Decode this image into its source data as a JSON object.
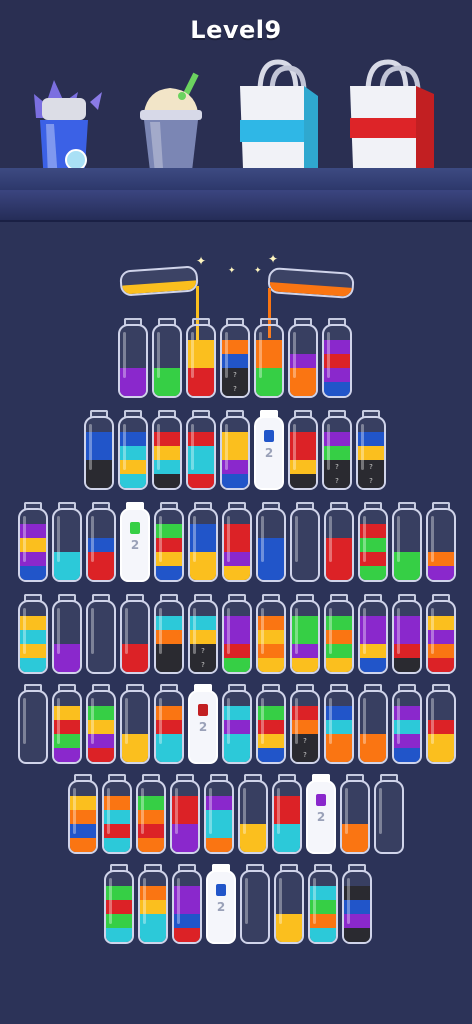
{
  "header": {
    "title": "Level9"
  },
  "colors": {
    "P": "#8a28cc",
    "G": "#36cf45",
    "R": "#dc2226",
    "Y": "#fbbf1e",
    "B": "#2155c9",
    "O": "#fa7512",
    "C": "#2cc9d9",
    "K": "#2a2a30",
    "W": "#f4f5fa"
  },
  "rewards": [
    {
      "name": "blue-cup-with-plant",
      "icon": "blue-drink-icon"
    },
    {
      "name": "milkshake",
      "icon": "milkshake-icon"
    },
    {
      "name": "shopping-bag-blue",
      "icon": "blue-shopping-bag-icon"
    },
    {
      "name": "shopping-bag-red",
      "icon": "red-shopping-bag-icon"
    }
  ],
  "pour_left": {
    "color": "Y"
  },
  "pour_right": {
    "color": "O"
  },
  "rows": [
    [
      [
        "P",
        "P"
      ],
      [
        "G",
        "G"
      ],
      [
        "R",
        "R",
        "Y",
        "Y"
      ],
      [
        "?",
        "?",
        "B",
        "O"
      ],
      [
        "G",
        "G",
        "O",
        "O"
      ],
      [
        "O",
        "O",
        "P"
      ],
      [
        "B",
        "P",
        "R",
        "P"
      ]
    ],
    [
      [
        "K",
        "K",
        "B",
        "B"
      ],
      [
        "C",
        "Y",
        "C",
        "B"
      ],
      [
        "K",
        "C",
        "Y",
        "R"
      ],
      [
        "R",
        "C",
        "C",
        "R"
      ],
      [
        "B",
        "P",
        "Y",
        "Y"
      ],
      [
        "W2"
      ],
      [
        "K",
        "Y",
        "R",
        "R"
      ],
      [
        "?",
        "?",
        "G",
        "P"
      ],
      [
        "?",
        "?",
        "Y",
        "B"
      ]
    ],
    [
      [
        "B",
        "P",
        "Y",
        "P"
      ],
      [
        "C",
        "C"
      ],
      [
        "R",
        "R",
        "B"
      ],
      [
        "W2"
      ],
      [
        "B",
        "Y",
        "R",
        "G"
      ],
      [
        "Y",
        "Y",
        "B",
        "B"
      ],
      [
        "Y",
        "P",
        "R",
        "R"
      ],
      [
        "B",
        "B",
        "B"
      ],
      [],
      [
        "R",
        "R",
        "R"
      ],
      [
        "G",
        "R",
        "G",
        "R"
      ],
      [
        "G",
        "G"
      ],
      [
        "P",
        "O"
      ]
    ],
    [
      [
        "C",
        "Y",
        "C",
        "Y"
      ],
      [
        "P",
        "P"
      ],
      [],
      [
        "R",
        "R"
      ],
      [
        "K",
        "K",
        "O",
        "C"
      ],
      [
        "?",
        "?",
        "Y",
        "C"
      ],
      [
        "G",
        "R",
        "P",
        "P"
      ],
      [
        "Y",
        "O",
        "Y",
        "O"
      ],
      [
        "Y",
        "P",
        "G",
        "G"
      ],
      [
        "Y",
        "G",
        "O",
        "G"
      ],
      [
        "B",
        "Y",
        "P",
        "P"
      ],
      [
        "K",
        "R",
        "P",
        "P"
      ],
      [
        "R",
        "O",
        "P",
        "Y"
      ]
    ],
    [
      [],
      [
        "P",
        "G",
        "R",
        "Y"
      ],
      [
        "R",
        "P",
        "Y",
        "G"
      ],
      [
        "Y",
        "Y"
      ],
      [
        "C",
        "C",
        "R",
        "O"
      ],
      [
        "W2"
      ],
      [
        "C",
        "C",
        "P",
        "C"
      ],
      [
        "B",
        "Y",
        "R",
        "G"
      ],
      [
        "?",
        "?",
        "O",
        "R"
      ],
      [
        "O",
        "O",
        "C",
        "B"
      ],
      [
        "O",
        "O"
      ],
      [
        "B",
        "P",
        "C",
        "P"
      ],
      [
        "Y",
        "Y",
        "R"
      ]
    ],
    [
      [
        "O",
        "B",
        "O",
        "Y"
      ],
      [
        "C",
        "R",
        "C",
        "O"
      ],
      [
        "O",
        "R",
        "O",
        "G"
      ],
      [
        "P",
        "P",
        "R",
        "R"
      ],
      [
        "O",
        "C",
        "C",
        "P"
      ],
      [
        "Y",
        "Y"
      ],
      [
        "C",
        "C",
        "R",
        "R"
      ],
      [
        "W2"
      ],
      [
        "O",
        "O"
      ],
      []
    ],
    [
      [
        "C",
        "G",
        "R",
        "G"
      ],
      [
        "C",
        "C",
        "Y",
        "O"
      ],
      [
        "R",
        "B",
        "P",
        "P"
      ],
      [
        "W2"
      ],
      [],
      [
        "Y",
        "Y"
      ],
      [
        "C",
        "O",
        "G",
        "C"
      ],
      [
        "K",
        "P",
        "B",
        "K"
      ]
    ]
  ],
  "row_tops": [
    318,
    410,
    502,
    594,
    684,
    774,
    864
  ],
  "row_lefts": [
    118,
    84,
    18,
    18,
    18,
    68,
    104
  ],
  "spacing": 34
}
